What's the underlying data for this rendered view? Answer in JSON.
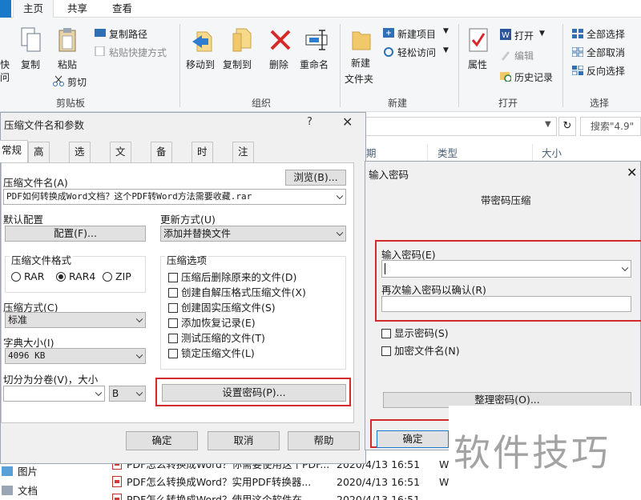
{
  "ribbon": {
    "tabs": [
      "主页",
      "共享",
      "查看"
    ],
    "left_cut": [
      "快",
      "问"
    ],
    "clipboard": {
      "copy": "复制",
      "paste": "粘贴",
      "copy_path": "复制路径",
      "paste_shortcut": "粘贴快捷方式",
      "cut": "剪切",
      "group": "剪贴板"
    },
    "organize": {
      "move_to": "移动到",
      "copy_to": "复制到",
      "delete": "删除",
      "rename": "重命名",
      "group": "组织"
    },
    "new": {
      "new_folder": "新建\n文件夹",
      "new_item": "新建项目",
      "easy_access": "轻松访问",
      "group": "新建"
    },
    "open": {
      "properties": "属性",
      "open": "打开",
      "edit": "编辑",
      "history": "历史记录",
      "group": "打开"
    },
    "select": {
      "select_all": "全部选择",
      "select_none": "全部取消",
      "invert": "反向选择",
      "group": "选择"
    }
  },
  "explorer": {
    "search_placeholder": "搜索\"4.9\"",
    "columns": {
      "name_cut": "期",
      "type": "类型",
      "size": "大小"
    },
    "nav": [
      {
        "label": "图片"
      },
      {
        "label": "文档"
      }
    ],
    "files": [
      {
        "name": "PDF怎么转换成Word？你需要使用这个PDF...",
        "date": "2020/4/13 16:51",
        "type_cut": "W"
      },
      {
        "name": "PDF怎么转换成Word？实用PDF转换器...",
        "date": "2020/4/13 16:51",
        "type_cut": "W"
      },
      {
        "name": "PDF怎么转换成Word？使用这个软件在...",
        "date": "2020/4/13 16:51",
        "type_cut": "W"
      }
    ]
  },
  "archive_dialog": {
    "title": "压缩文件名和参数",
    "help": "?",
    "tabs": [
      "常规",
      "高级",
      "选项",
      "文件",
      "备份",
      "时间",
      "注释"
    ],
    "archive_name_label": "压缩文件名(A)",
    "browse": "浏览(B)...",
    "archive_name": "PDF如何转换成Word文档？这个PDF转Word方法需要收藏.rar",
    "default_profile_label": "默认配置",
    "profiles_button": "配置(F)...",
    "update_mode_label": "更新方式(U)",
    "update_mode": "添加并替换文件",
    "format_label": "压缩文件格式",
    "formats": [
      "RAR",
      "RAR4",
      "ZIP"
    ],
    "format_selected": "RAR4",
    "options_label": "压缩选项",
    "options": [
      "压缩后删除原来的文件(D)",
      "创建自解压格式压缩文件(X)",
      "创建固实压缩文件(S)",
      "添加恢复记录(E)",
      "测试压缩的文件(T)",
      "锁定压缩文件(L)"
    ],
    "method_label": "压缩方式(C)",
    "method": "标准",
    "dict_label": "字典大小(I)",
    "dict": "4096 KB",
    "split_label": "切分为分卷(V)，大小",
    "split_unit": "B",
    "set_password": "设置密码(P)...",
    "ok": "确定",
    "cancel": "取消",
    "help_btn": "帮助"
  },
  "password_dialog": {
    "title": "输入密码",
    "subtitle": "带密码压缩",
    "enter_label": "输入密码(E)",
    "confirm_label": "再次输入密码以确认(R)",
    "show_password": "显示密码(S)",
    "encrypt_names": "加密文件名(N)",
    "organize": "整理密码(O)...",
    "ok": "确定"
  },
  "watermark": "软件技巧",
  "colors": {
    "highlight": "#d22b2b",
    "accent": "#1979ca"
  }
}
